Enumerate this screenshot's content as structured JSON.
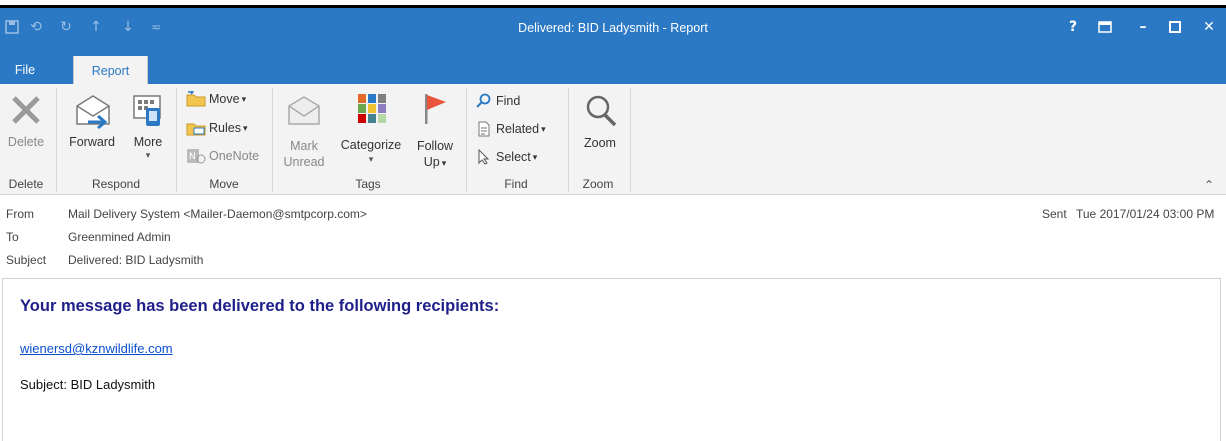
{
  "window": {
    "title": "Delivered: BID Ladysmith - Report",
    "controls": {
      "help": "?",
      "restore_ribbon": "▣",
      "minimize": "–",
      "maximize": "☐",
      "close": "✕"
    }
  },
  "tabs": {
    "file": "File",
    "report": "Report"
  },
  "ribbon": {
    "delete": {
      "label": "Delete",
      "group": "Delete"
    },
    "respond": {
      "forward": "Forward",
      "more": "More",
      "group": "Respond"
    },
    "move": {
      "move": "Move",
      "rules": "Rules",
      "onenote": "OneNote",
      "group": "Move"
    },
    "tags": {
      "mark_unread_1": "Mark",
      "mark_unread_2": "Unread",
      "categorize": "Categorize",
      "follow_up_1": "Follow",
      "follow_up_2": "Up",
      "group": "Tags"
    },
    "find": {
      "find": "Find",
      "related": "Related",
      "select": "Select",
      "group": "Find"
    },
    "zoom": {
      "label": "Zoom",
      "group": "Zoom"
    }
  },
  "header": {
    "from_label": "From",
    "from_value": "Mail Delivery System <Mailer-Daemon@smtpcorp.com>",
    "to_label": "To",
    "to_value": "Greenmined Admin",
    "subject_label": "Subject",
    "subject_value": "Delivered: BID Ladysmith",
    "sent_label": "Sent",
    "sent_value": "Tue 2017/01/24 03:00 PM"
  },
  "message": {
    "headline": "Your message has been delivered to the following recipients:",
    "recipient": "wienersd@kznwildlife.com",
    "subject_line": "Subject: BID Ladysmith"
  },
  "colors": {
    "accent": "#2b79c4",
    "headline": "#1f1f8a",
    "link": "#0b4fcf"
  }
}
